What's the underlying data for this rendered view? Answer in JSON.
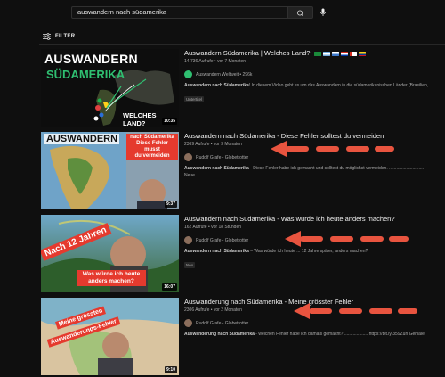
{
  "search": {
    "query": "auswandern nach südamerika"
  },
  "filter": {
    "label": "FILTER"
  },
  "results": [
    {
      "title": "Auswandern Südamerika | Welches Land?",
      "views": "14.736 Aufrufe • vor 7 Monaten",
      "channel": "Auswandern Weltweit • 296k",
      "desc_bold": "Auswandern nach Südamerika",
      "desc_rest": "! In diesem Video geht es um das Auswandern in die südamerikanischen Länder (Brasilien, ...",
      "badge": "Untertitel",
      "duration": "10:35",
      "thumb_text": [
        "AUSWANDERN",
        "SÜDAMERIKA",
        "WELCHES LAND?"
      ]
    },
    {
      "title": "Auswandern nach Südamerika - Diese Fehler solltest du vermeiden",
      "views": "2369 Aufrufe • vor 3 Monaten",
      "channel": "Rudolf Grafe - Globetrotter",
      "desc_bold": "Auswandern nach Südamerika",
      "desc_rest": " - Diese Fehler habe ich gemacht und solltest du möglichst vermeiden. ............................",
      "desc_line2": "Neue ...",
      "duration": "9:37",
      "thumb_text": [
        "AUSWANDERN",
        "nach Südamerika",
        "Diese Fehler",
        "musst",
        "du vermeiden"
      ]
    },
    {
      "title": "Auswandern nach Südamerika - Was würde ich heute anders machen?",
      "views": "162 Aufrufe • vor 18 Stunden",
      "channel": "Rudolf Grafe - Globetrotter",
      "desc_bold": "Auswandern nach Südamerika",
      "desc_rest": " – Was würde ich heute ... 12 Jahre später, anders machen?",
      "badge": "Neu",
      "duration": "16:07",
      "thumb_text": [
        "Nach 12 Jahren",
        "Was würde ich heute",
        "anders machen?"
      ]
    },
    {
      "title": "Auswanderung nach Südamerika - Meine grösster Fehler",
      "views": "2306 Aufrufe • vor 2 Monaten",
      "channel": "Rudolf Grafe - Globetrotter",
      "desc_bold": "Auswanderung nach Südamerika",
      "desc_rest": " - welchen Fehler habe ich damals gemacht? ................... https://bit.ly/359Zurl Geniale",
      "duration": "9:10",
      "thumb_text": [
        "Meine grössten",
        "Auswanderungs-Fehler"
      ]
    }
  ],
  "colors": {
    "arrow": "#e8543f",
    "bg": "#0f0f0f",
    "badge_bg": "#272727",
    "channel_avatar_green": "#2fbf71"
  },
  "icons": [
    "search-icon",
    "mic-icon",
    "filter-icon",
    "arrow-annotation"
  ]
}
